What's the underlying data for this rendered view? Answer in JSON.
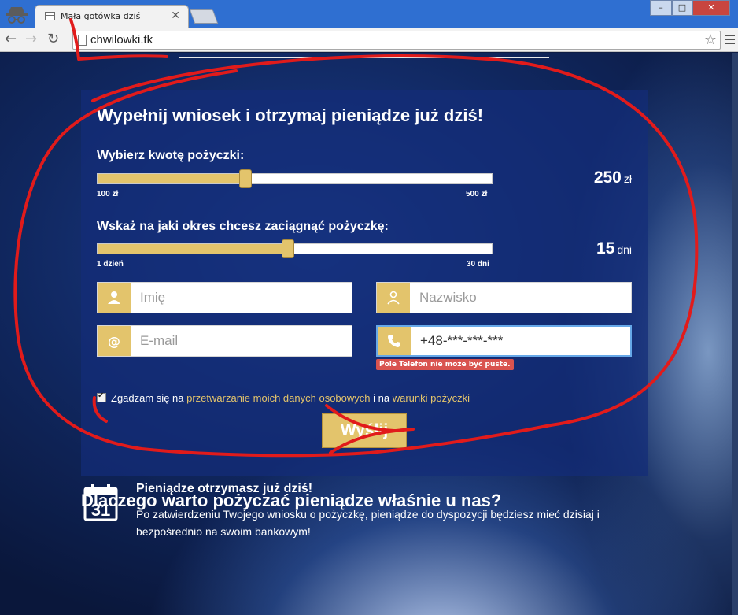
{
  "browser": {
    "tab_title": "Mała gotówka dziś",
    "url": "chwilowki.tk",
    "window_controls": [
      "–",
      "□",
      "✕"
    ]
  },
  "form": {
    "title": "Wypełnij wniosek i otrzymaj pieniądze już dziś!",
    "amount": {
      "label": "Wybierz kwotę pożyczki:",
      "min_label": "100 zł",
      "max_label": "500 zł",
      "min": 100,
      "max": 500,
      "value": 250,
      "value_text": "250",
      "unit": "zł"
    },
    "period": {
      "label": "Wskaż na jaki okres chcesz zaciągnąć pożyczkę:",
      "min_label": "1 dzień",
      "max_label": "30 dni",
      "min": 1,
      "max": 30,
      "value": 15,
      "value_text": "15",
      "unit": "dni"
    },
    "fields": {
      "first_name_placeholder": "Imię",
      "last_name_placeholder": "Nazwisko",
      "email_placeholder": "E-mail",
      "phone_value": "+48-***-***-***",
      "email_addon": "@"
    },
    "phone_error": "Pole Telefon nie może być puste.",
    "consent": {
      "text_before": "Zgadzam się na ",
      "link1": "przetwarzanie moich danych osobowych",
      "text_middle": " i na ",
      "link2": "warunki pożyczki",
      "checked": true
    },
    "submit_label": "Wyślij"
  },
  "why": {
    "title": "Dlaczego warto pożyczać pieniądze właśnie u nas?",
    "feature_title": "Pieniądze otrzymasz już dziś!",
    "feature_text": "Po zatwierdzeniu Twojego wniosku o pożyczkę, pieniądze do dyspozycji będziesz mieć dzisiaj i bezpośrednio na swoim bankowym!",
    "calendar_day": "31"
  },
  "colors": {
    "accent": "#e3c46c",
    "annotation": "#e11b1b",
    "error": "#d9534f"
  }
}
